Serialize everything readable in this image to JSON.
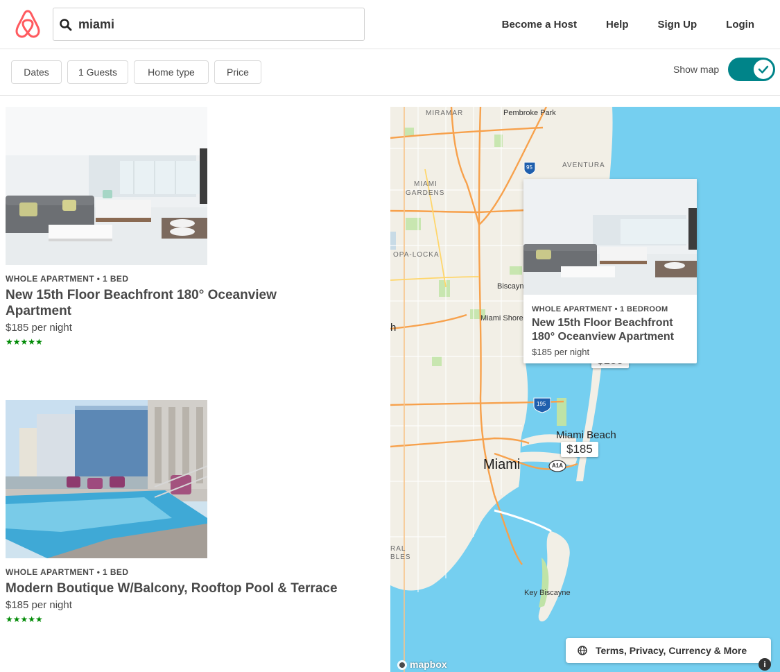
{
  "header": {
    "search_value": "miami",
    "nav": [
      "Become a Host",
      "Help",
      "Sign Up",
      "Login"
    ]
  },
  "filters": {
    "buttons": [
      "Dates",
      "1 Guests",
      "Home type",
      "Price"
    ],
    "show_map_label": "Show map",
    "show_map_on": true
  },
  "listings": [
    {
      "kicker": "WHOLE APARTMENT • 1 BED",
      "title": "New 15th Floor Beachfront 180° Oceanview Apartment",
      "price": "$185 per night",
      "stars": "★★★★★"
    },
    {
      "kicker": "WHOLE APARTMENT • 1 BED",
      "title": "Modern Boutique W/Balcony, Rooftop Pool & Terrace",
      "price": "$185 per night",
      "stars": "★★★★★"
    }
  ],
  "map": {
    "labels": {
      "miramar": "MIRAMAR",
      "pembroke_park": "Pembroke Park",
      "aventura": "AVENTURA",
      "miami_gardens_1": "MIAMI",
      "miami_gardens_2": "GARDENS",
      "opa_locka": "OPA-LOCKA",
      "biscayne": "Biscayne",
      "miami_shores": "Miami Shores",
      "miami_beach": "Miami Beach",
      "miami": "Miami",
      "key_biscayne": "Key Biscayne",
      "i95": "95",
      "i195": "195",
      "a1a": "A1A",
      "edge_h": "h",
      "edge_ral": "RAL",
      "edge_bles": "BLES"
    },
    "markers": [
      "$185",
      "$185"
    ],
    "popup": {
      "kicker": "WHOLE APARTMENT • 1 BEDROOM",
      "title": "New 15th Floor Beachfront 180° Oceanview Apartment",
      "price": "$185 per night"
    },
    "footer_button": "Terms, Privacy, Currency & More",
    "attribution": "mapbox",
    "info": "i"
  },
  "colors": {
    "brand": "#ff5a5f",
    "toggle": "#008489",
    "stars": "#008a05",
    "water": "#75cff0",
    "land": "#f2efe6",
    "roads": "#f7a14c",
    "park": "#c8e6b0"
  }
}
